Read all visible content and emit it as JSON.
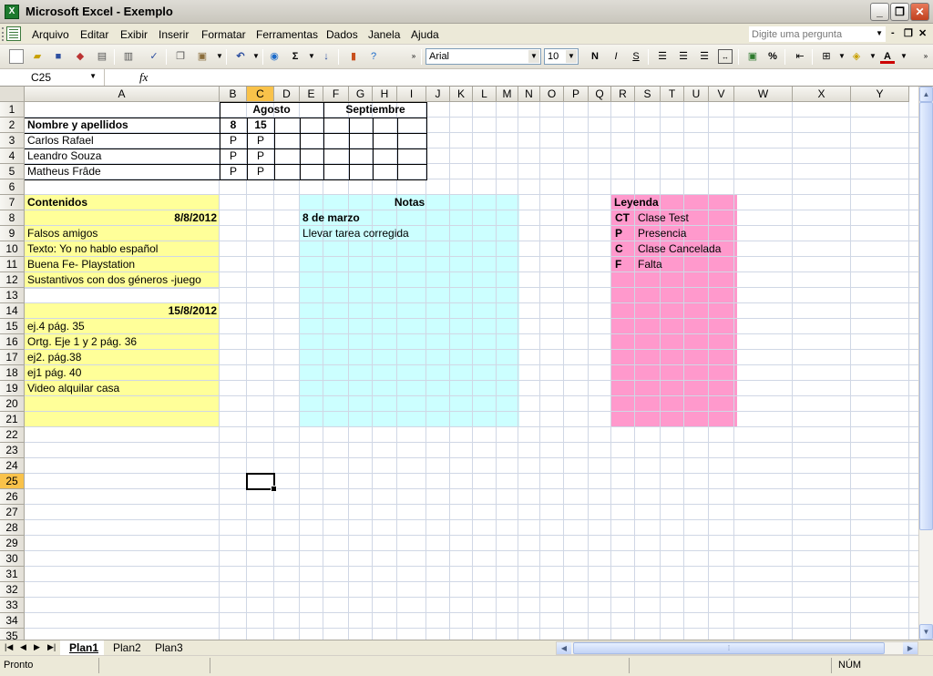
{
  "window": {
    "title": "Microsoft Excel - Exemplo",
    "app_icon": "excel-icon",
    "min": "_",
    "max": "❐",
    "close": "✕"
  },
  "menu": {
    "items": [
      "Arquivo",
      "Editar",
      "Exibir",
      "Inserir",
      "Formatar",
      "Ferramentas",
      "Dados",
      "Janela",
      "Ajuda"
    ],
    "ask_placeholder": "Digite uma pergunta",
    "doc_min": "-",
    "doc_restore": "❐",
    "doc_close": "✕"
  },
  "toolbar": {
    "font": "Arial",
    "size": "10",
    "bold": "N",
    "italic": "I",
    "underline": "S",
    "autosum": "Σ",
    "percent": "%"
  },
  "formula_bar": {
    "name_box": "C25",
    "fx": "fx",
    "content": ""
  },
  "columns": [
    "A",
    "B",
    "C",
    "D",
    "E",
    "F",
    "G",
    "H",
    "I",
    "J",
    "K",
    "L",
    "M",
    "N",
    "O",
    "P",
    "Q",
    "R",
    "S",
    "T",
    "U",
    "V",
    "W",
    "X",
    "Y"
  ],
  "selected_column": "C",
  "rows": [
    "1",
    "2",
    "3",
    "4",
    "5",
    "6",
    "7",
    "8",
    "9",
    "10",
    "11",
    "12",
    "13",
    "14",
    "15",
    "16",
    "17",
    "18",
    "19",
    "20",
    "21",
    "22",
    "23",
    "24",
    "25",
    "26",
    "27",
    "28",
    "29",
    "30",
    "31",
    "32",
    "33",
    "34",
    "35"
  ],
  "selected_row": "25",
  "attendance": {
    "month1": "Agosto",
    "month2": "Septiembre",
    "name_header": "Nombre y apellidos",
    "day1": "8",
    "day2": "15",
    "students": [
      {
        "name": "Carlos Rafael",
        "d1": "P",
        "d2": "P"
      },
      {
        "name": "Leandro Souza",
        "d1": "P",
        "d2": "P"
      },
      {
        "name": "Matheus Frâde",
        "d1": "P",
        "d2": "P"
      }
    ]
  },
  "contenidos": {
    "title": "Contenidos",
    "date1": "8/8/2012",
    "items1": [
      "Falsos amigos",
      "Texto: Yo no hablo español",
      "Buena Fe- Playstation",
      "Sustantivos con dos géneros -juego"
    ],
    "date2": "15/8/2012",
    "items2": [
      "ej.4 pág. 35",
      "Ortg. Eje 1 y 2 pág. 36",
      "ej2. pág.38",
      "ej1 pág. 40",
      "Video alquilar casa"
    ],
    "color": "#ffff99"
  },
  "notas": {
    "title": "Notas",
    "date": "8 de marzo",
    "text": "Llevar tarea corregida",
    "color": "#ccffff"
  },
  "leyenda": {
    "title": "Leyenda",
    "entries": [
      {
        "code": "CT",
        "desc": "Clase Test"
      },
      {
        "code": "P",
        "desc": "Presencia"
      },
      {
        "code": "C",
        "desc": "Clase Cancelada"
      },
      {
        "code": "F",
        "desc": "Falta"
      }
    ],
    "color": "#ff99cc"
  },
  "sheets": [
    "Plan1",
    "Plan2",
    "Plan3"
  ],
  "active_sheet": "Plan1",
  "status": {
    "left": "Pronto",
    "num": "NÚM"
  }
}
